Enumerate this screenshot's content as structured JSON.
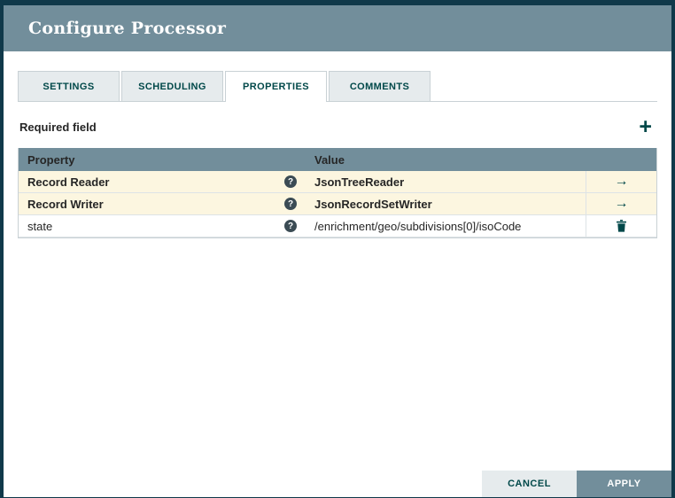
{
  "dialog": {
    "title": "Configure Processor"
  },
  "tabs": [
    {
      "label": "SETTINGS"
    },
    {
      "label": "SCHEDULING"
    },
    {
      "label": "PROPERTIES"
    },
    {
      "label": "COMMENTS"
    }
  ],
  "properties_tab": {
    "required_field_label": "Required field",
    "table": {
      "columns": {
        "property": "Property",
        "value": "Value"
      },
      "rows": [
        {
          "property": "Record Reader",
          "value": "JsonTreeReader",
          "action": "go-to",
          "highlighted": true
        },
        {
          "property": "Record Writer",
          "value": "JsonRecordSetWriter",
          "action": "go-to",
          "highlighted": true
        },
        {
          "property": "state",
          "value": "/enrichment/geo/subdivisions[0]/isoCode",
          "action": "delete",
          "highlighted": false
        }
      ]
    }
  },
  "icons": {
    "add": "+",
    "help": "?",
    "go_to": "→"
  },
  "footer": {
    "cancel_label": "CANCEL",
    "apply_label": "APPLY"
  },
  "colors": {
    "header_bg": "#728e9b",
    "accent_teal": "#004849",
    "row_highlight": "#fcf6e0",
    "table_header_bg": "#728e9b",
    "backdrop": "#10394a"
  }
}
